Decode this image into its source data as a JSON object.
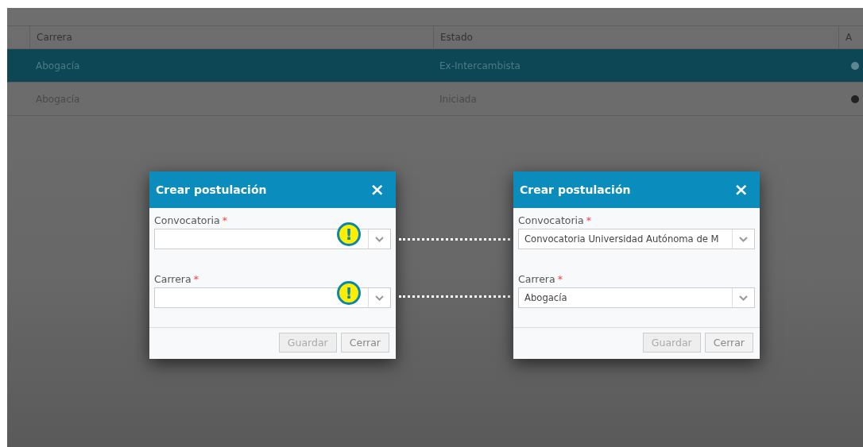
{
  "table": {
    "columns": [
      "Carrera",
      "Estado",
      "A"
    ],
    "rows": [
      {
        "cells": [
          "Abogacía",
          "Ex-Intercambista"
        ],
        "selected": true
      },
      {
        "cells": [
          "Abogacía",
          "Iniciada"
        ],
        "selected": false
      }
    ]
  },
  "dialogs": [
    {
      "title": "Crear postulación",
      "close": "×",
      "fields": [
        {
          "label": "Convocatoria",
          "required_mark": "*",
          "callout": "!"
        },
        {
          "label": "Carrera",
          "required_mark": "*",
          "callout": "!"
        }
      ],
      "buttons": [
        {
          "label": "Guardar",
          "disabled": true
        },
        {
          "label": "Cerrar",
          "disabled": false
        }
      ]
    },
    {
      "title": "Crear postulación",
      "close": "×",
      "fields": [
        {
          "label": "Convocatoria",
          "required_mark": "*",
          "value": "Convocatoria Universidad Autónoma de M"
        },
        {
          "label": "Carrera",
          "required_mark": "*",
          "value": "Abogacía"
        }
      ],
      "buttons": [
        {
          "label": "Guardar",
          "disabled": true
        },
        {
          "label": "Cerrar",
          "disabled": false
        }
      ]
    }
  ]
}
